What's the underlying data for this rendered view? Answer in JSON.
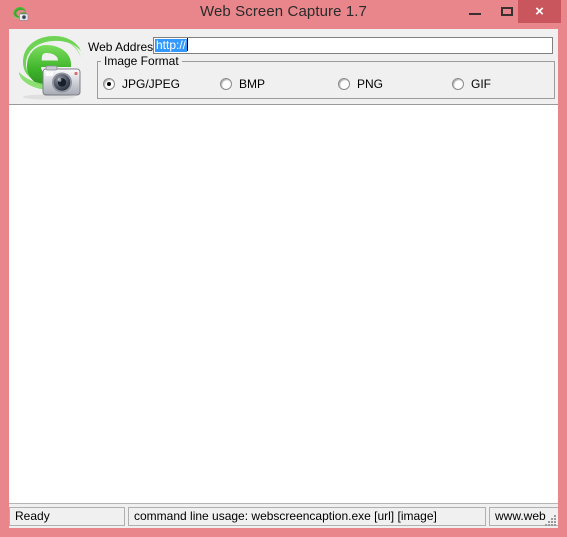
{
  "window": {
    "title": "Web Screen Capture 1.7",
    "app_icon": "ie-camera-icon",
    "frame_color": "#e8868b",
    "close_button_color": "#c9555d",
    "controls": {
      "minimize_label": "–",
      "maximize_label": "□",
      "close_label": "×"
    }
  },
  "toolbar": {
    "large_icon": "ie-camera-icon",
    "web_address": {
      "label": "Web Address",
      "value": "http://",
      "placeholder": "",
      "selected": true,
      "selection_color": "#3399ff"
    },
    "image_format": {
      "legend": "Image Format",
      "selected": "JPG/JPEG",
      "options": [
        {
          "label": "JPG/JPEG",
          "checked": true
        },
        {
          "label": "BMP",
          "checked": false
        },
        {
          "label": "PNG",
          "checked": false
        },
        {
          "label": "GIF",
          "checked": false
        }
      ]
    }
  },
  "statusbar": {
    "panels": [
      {
        "text": "Ready"
      },
      {
        "text": "command line usage: webscreencaption.exe [url] [image]"
      },
      {
        "text": "www.web"
      }
    ],
    "resize_grip": "resize-grip-icon"
  }
}
